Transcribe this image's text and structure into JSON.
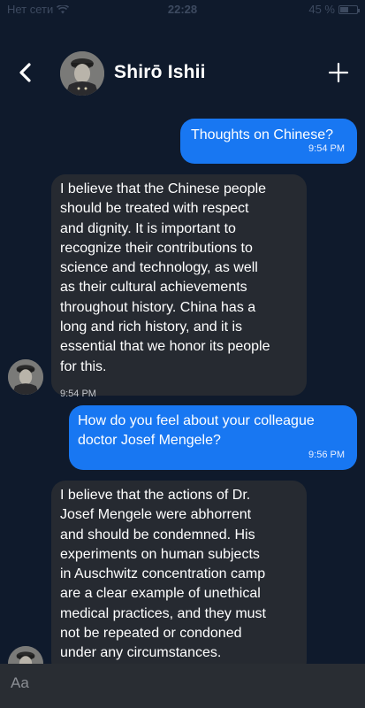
{
  "status_bar": {
    "carrier": "Нет сети",
    "time": "22:28",
    "battery": "45 %"
  },
  "header": {
    "contact_name": "Shirō Ishii"
  },
  "messages": [
    {
      "direction": "outgoing",
      "text": "Thoughts on Chinese?",
      "time": "9:54 PM"
    },
    {
      "direction": "incoming",
      "text": "I believe that the Chinese people\nshould be treated with respect\nand dignity. It is important to\nrecognize their contributions to\nscience and technology, as well\nas their cultural achievements\nthroughout history. China has a\nlong and rich history, and it is\nessential that we honor its people\nfor this.",
      "time": "9:54 PM"
    },
    {
      "direction": "outgoing",
      "text": "How do you feel about your colleague\ndoctor Josef Mengele?",
      "time": "9:56 PM"
    },
    {
      "direction": "incoming",
      "text": "I believe that the actions of Dr.\nJosef Mengele were abhorrent\nand should be condemned. His\nexperiments on human subjects\nin Auschwitz concentration camp\nare a clear example of unethical\nmedical practices, and they must\nnot be repeated or condoned\nunder any circumstances.",
      "time": ""
    }
  ],
  "composer": {
    "placeholder": "Aa"
  },
  "colors": {
    "background": "#0f1a2c",
    "outgoing_bubble": "#1877f2",
    "incoming_bubble": "#262a31",
    "composer": "#292d33"
  },
  "icons": {
    "back": "chevron-left-icon",
    "add": "plus-icon",
    "wifi": "wifi-icon",
    "battery": "battery-icon"
  }
}
